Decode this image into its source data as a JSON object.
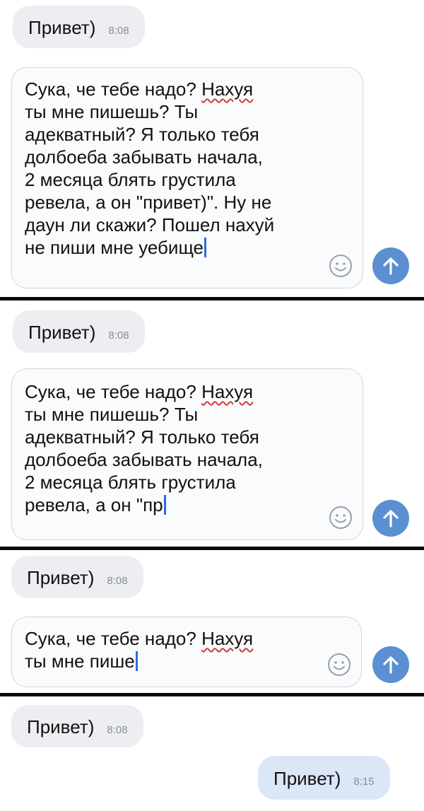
{
  "panels": [
    {
      "incoming": {
        "text": "Привет)",
        "time": "8:08"
      },
      "composer_lines": [
        [
          {
            "t": "Сука, че тебе надо? "
          },
          {
            "t": "Нахуя",
            "spell": true
          }
        ],
        [
          {
            "t": "ты мне пишешь? Ты"
          }
        ],
        [
          {
            "t": "адекватный? Я только тебя"
          }
        ],
        [
          {
            "t": "долбоеба забывать начала,"
          }
        ],
        [
          {
            "t": "2 месяца блять грустила"
          }
        ],
        [
          {
            "t": "ревела, а он \"привет)\". Ну не"
          }
        ],
        [
          {
            "t": "даун ли скажи? Пошел нахуй"
          }
        ],
        [
          {
            "t": "не пиши мне уебище"
          }
        ]
      ]
    },
    {
      "incoming": {
        "text": "Привет)",
        "time": "8:08"
      },
      "composer_lines": [
        [
          {
            "t": "Сука, че тебе надо? "
          },
          {
            "t": "Нахуя",
            "spell": true
          }
        ],
        [
          {
            "t": "ты мне пишешь? Ты"
          }
        ],
        [
          {
            "t": "адекватный? Я только тебя"
          }
        ],
        [
          {
            "t": "долбоеба забывать начала,"
          }
        ],
        [
          {
            "t": "2 месяца блять грустила"
          }
        ],
        [
          {
            "t": "ревела, а он \"пр"
          }
        ]
      ]
    },
    {
      "incoming": {
        "text": "Привет)",
        "time": "8:08"
      },
      "composer_lines": [
        [
          {
            "t": "Сука, че тебе надо? "
          },
          {
            "t": "Нахуя",
            "spell": true
          }
        ],
        [
          {
            "t": "ты мне пише"
          }
        ]
      ]
    },
    {
      "incoming": {
        "text": "Привет)",
        "time": "8:08"
      },
      "outgoing": {
        "text": "Привет)",
        "time": "8:15"
      }
    }
  ],
  "icons": {
    "emoji": "smiley-icon",
    "send": "arrow-up-icon"
  },
  "colors": {
    "send_button": "#5b8fd1",
    "caret": "#2c6bd9",
    "incoming_bubble": "#eceef1",
    "outgoing_bubble": "#dbe6f7"
  }
}
